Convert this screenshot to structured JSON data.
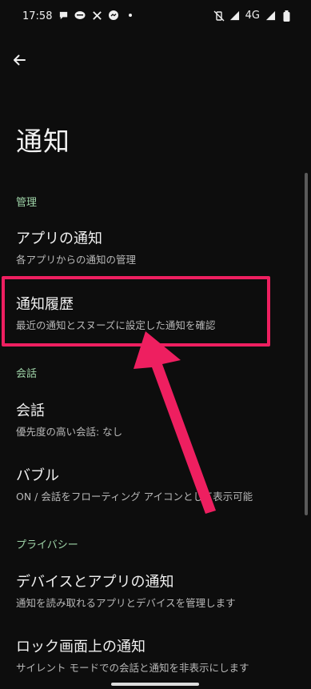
{
  "status_bar": {
    "time": "17:58",
    "network": "4G"
  },
  "page": {
    "title": "通知"
  },
  "sections": {
    "manage": "管理",
    "conversation": "会話",
    "privacy": "プライバシー"
  },
  "items": {
    "app_notifications": {
      "title": "アプリの通知",
      "subtitle": "各アプリからの通知の管理"
    },
    "notification_history": {
      "title": "通知履歴",
      "subtitle": "最近の通知とスヌーズに設定した通知を確認"
    },
    "conversations": {
      "title": "会話",
      "subtitle": "優先度の高い会話: なし"
    },
    "bubbles": {
      "title": "バブル",
      "subtitle": "ON / 会話をフローティング アイコンとして表示可能"
    },
    "device_app_notifications": {
      "title": "デバイスとアプリの通知",
      "subtitle": "通知を読み取れるアプリとデバイスを管理します"
    },
    "lock_screen": {
      "title": "ロック画面上の通知",
      "subtitle": "サイレント モードでの会話と通知を非表示にします"
    }
  },
  "colors": {
    "accent": "#9fd4a8",
    "highlight": "#ee1f60",
    "background": "#0d0d0d"
  }
}
